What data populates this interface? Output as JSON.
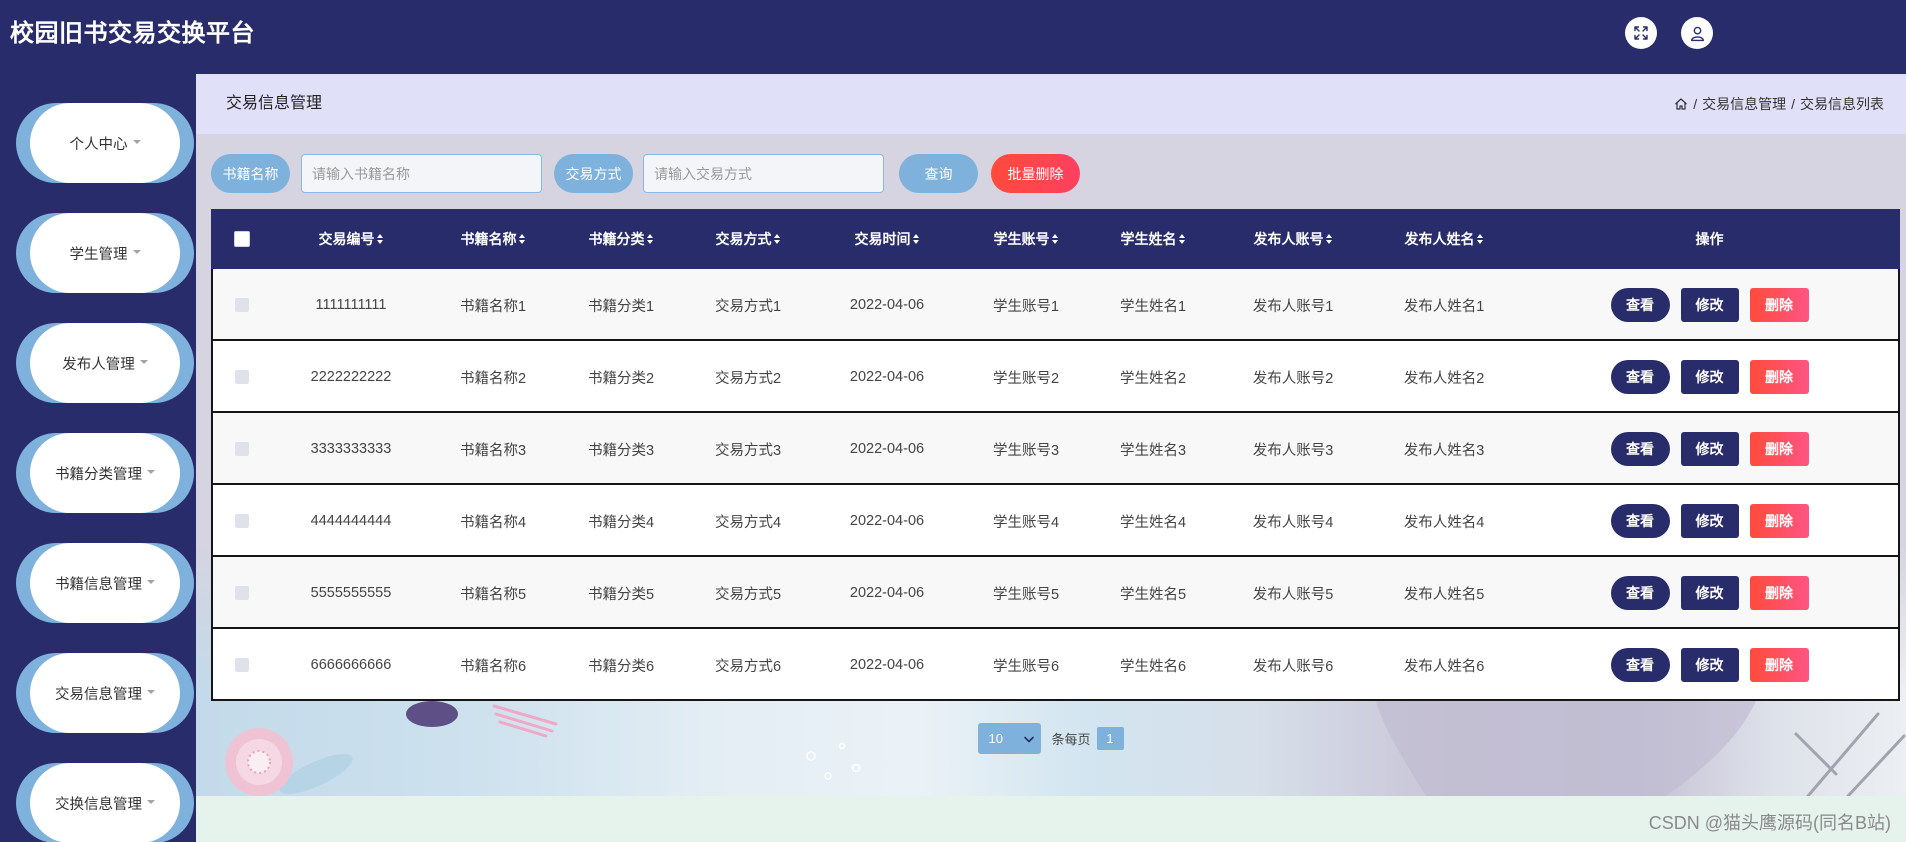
{
  "app": {
    "title": "校园旧书交易交换平台"
  },
  "header": {
    "actions": [
      {
        "icon": "fullscreen-icon"
      },
      {
        "icon": "user-icon"
      }
    ]
  },
  "sidebar": {
    "items": [
      {
        "label": "个人中心",
        "icon": "caret-down-icon"
      },
      {
        "label": "学生管理",
        "icon": "caret-down-icon"
      },
      {
        "label": "发布人管理",
        "icon": "caret-down-icon"
      },
      {
        "label": "书籍分类管理",
        "icon": "caret-down-icon"
      },
      {
        "label": "书籍信息管理",
        "icon": "caret-down-icon"
      },
      {
        "label": "交易信息管理",
        "icon": "caret-down-icon"
      },
      {
        "label": "交换信息管理",
        "icon": "caret-down-icon"
      }
    ]
  },
  "breadcrumb": {
    "page_title": "交易信息管理",
    "home_icon": "home-icon",
    "separator": "/",
    "trail": [
      "交易信息管理",
      "交易信息列表"
    ]
  },
  "search": {
    "fields": [
      {
        "label": "书籍名称",
        "placeholder": "请输入书籍名称",
        "value": ""
      },
      {
        "label": "交易方式",
        "placeholder": "请输入交易方式",
        "value": ""
      }
    ],
    "query_label": "查询",
    "batch_delete_label": "批量删除"
  },
  "table": {
    "columns": [
      "交易编号",
      "书籍名称",
      "书籍分类",
      "交易方式",
      "交易时间",
      "学生账号",
      "学生姓名",
      "发布人账号",
      "发布人姓名",
      "操作"
    ],
    "rows": [
      {
        "trade_id": "1111111111",
        "book_name": "书籍名称1",
        "book_category": "书籍分类1",
        "trade_method": "交易方式1",
        "trade_time": "2022-04-06",
        "student_account": "学生账号1",
        "student_name": "学生姓名1",
        "publisher_account": "发布人账号1",
        "publisher_name": "发布人姓名1"
      },
      {
        "trade_id": "2222222222",
        "book_name": "书籍名称2",
        "book_category": "书籍分类2",
        "trade_method": "交易方式2",
        "trade_time": "2022-04-06",
        "student_account": "学生账号2",
        "student_name": "学生姓名2",
        "publisher_account": "发布人账号2",
        "publisher_name": "发布人姓名2"
      },
      {
        "trade_id": "3333333333",
        "book_name": "书籍名称3",
        "book_category": "书籍分类3",
        "trade_method": "交易方式3",
        "trade_time": "2022-04-06",
        "student_account": "学生账号3",
        "student_name": "学生姓名3",
        "publisher_account": "发布人账号3",
        "publisher_name": "发布人姓名3"
      },
      {
        "trade_id": "4444444444",
        "book_name": "书籍名称4",
        "book_category": "书籍分类4",
        "trade_method": "交易方式4",
        "trade_time": "2022-04-06",
        "student_account": "学生账号4",
        "student_name": "学生姓名4",
        "publisher_account": "发布人账号4",
        "publisher_name": "发布人姓名4"
      },
      {
        "trade_id": "5555555555",
        "book_name": "书籍名称5",
        "book_category": "书籍分类5",
        "trade_method": "交易方式5",
        "trade_time": "2022-04-06",
        "student_account": "学生账号5",
        "student_name": "学生姓名5",
        "publisher_account": "发布人账号5",
        "publisher_name": "发布人姓名5"
      },
      {
        "trade_id": "6666666666",
        "book_name": "书籍名称6",
        "book_category": "书籍分类6",
        "trade_method": "交易方式6",
        "trade_time": "2022-04-06",
        "student_account": "学生账号6",
        "student_name": "学生姓名6",
        "publisher_account": "发布人账号6",
        "publisher_name": "发布人姓名6"
      }
    ],
    "actions": {
      "view": "查看",
      "edit": "修改",
      "delete": "删除"
    }
  },
  "pagination": {
    "page_size": "10",
    "page_size_suffix": "条每页",
    "current_page": "1"
  },
  "watermark": "CSDN @猫头鹰源码(同名B站)",
  "colors": {
    "primary": "#292c6b",
    "accent": "#7fb1dd",
    "danger": "#ff4a3c",
    "breadcrumb_bg": "#e0e1f9",
    "footer_strip": "#e6f3ed"
  }
}
